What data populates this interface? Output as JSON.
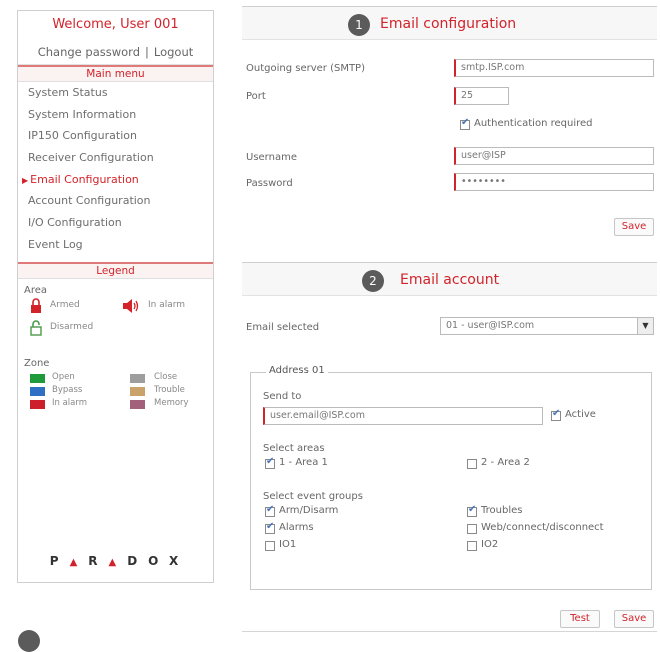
{
  "sidebar": {
    "welcome": "Welcome, User 001",
    "change_password": "Change password",
    "separator": "|",
    "logout": "Logout",
    "main_menu_title": "Main menu",
    "menu": [
      "System Status",
      "System Information",
      "IP150 Configuration",
      "Receiver Configuration",
      "Email Configuration",
      "Account Configuration",
      "I/O Configuration",
      "Event Log"
    ],
    "active_index": 4,
    "legend_title": "Legend",
    "area_label": "Area",
    "area_items": [
      "Armed",
      "Disarmed",
      "In alarm"
    ],
    "zone_label": "Zone",
    "zone_items": [
      {
        "label": "Open",
        "color": "#1f9a3a"
      },
      {
        "label": "Close",
        "color": "#9e9e9e"
      },
      {
        "label": "Bypass",
        "color": "#2f6fc4"
      },
      {
        "label": "Trouble",
        "color": "#c9a36b"
      },
      {
        "label": "In alarm",
        "color": "#cc1f2b"
      },
      {
        "label": "Memory",
        "color": "#a3607a"
      }
    ],
    "logo": "PARADOX"
  },
  "panel1": {
    "step": "1",
    "title": "Email configuration",
    "smtp_label": "Outgoing server (SMTP)",
    "smtp_value": "smtp.ISP.com",
    "port_label": "Port",
    "port_value": "25",
    "auth_label": "Authentication required",
    "username_label": "Username",
    "username_value": "user@ISP",
    "password_label": "Password",
    "password_value": "••••••••",
    "save_label": "Save"
  },
  "panel2": {
    "step": "2",
    "title": "Email account",
    "email_selected_label": "Email selected",
    "email_selected_value": "01 - user@ISP.com",
    "address_legend": "Address 01",
    "send_to_label": "Send to",
    "send_to_value": "user.email@ISP.com",
    "active_label": "Active",
    "areas_label": "Select areas",
    "areas": [
      "1 - Area 1",
      "2 - Area 2"
    ],
    "events_label": "Select event groups",
    "events": [
      "Arm/Disarm",
      "Troubles",
      "Alarms",
      "Web/connect/disconnect",
      "IO1",
      "IO2"
    ],
    "test_label": "Test",
    "save_label": "Save"
  }
}
